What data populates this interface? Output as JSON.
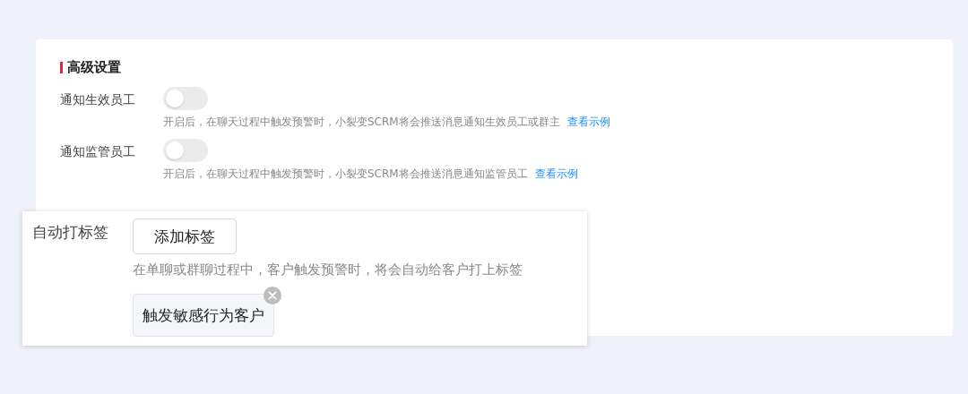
{
  "section_title": "高级设置",
  "settings": [
    {
      "label": "通知生效员工",
      "on": false,
      "hint": "开启后，在聊天过程中触发预警时，小裂变SCRM将会推送消息通知生效员工或群主",
      "link": "查看示例"
    },
    {
      "label": "通知监管员工",
      "on": false,
      "hint": "开启后，在聊天过程中触发预警时，小裂变SCRM将会推送消息通知监管员工",
      "link": "查看示例"
    }
  ],
  "auto_tag_panel": {
    "label": "自动打标签",
    "button": "添加标签",
    "hint": "在单聊或群聊过程中，客户触发预警时，将会自动给客户打上标签",
    "tags": [
      {
        "label": "触发敏感行为客户"
      }
    ]
  }
}
